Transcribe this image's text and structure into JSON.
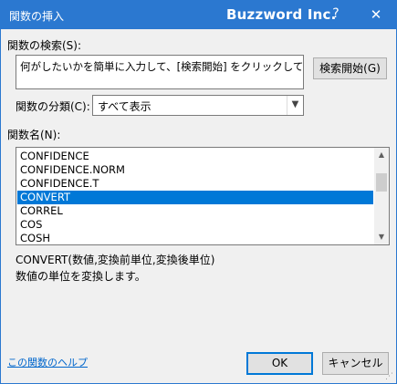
{
  "window": {
    "title": "関数の挿入",
    "brand": "Buzzword Inc.",
    "help_glyph": "?",
    "close_glyph": "✕"
  },
  "search": {
    "label": "関数の検索(S):",
    "text": "何がしたいかを簡単に入力して、[検索開始] をクリックしてください。",
    "button_label": "検索開始(G)"
  },
  "category": {
    "label": "関数の分類(C):",
    "selected": "すべて表示"
  },
  "function_list": {
    "label": "関数名(N):",
    "items": [
      "CONFIDENCE",
      "CONFIDENCE.NORM",
      "CONFIDENCE.T",
      "CONVERT",
      "CORREL",
      "COS",
      "COSH"
    ],
    "selected_index": 3
  },
  "description": {
    "syntax": "CONVERT(数値,変換前単位,変換後単位)",
    "text": "数値の単位を変換します。"
  },
  "footer": {
    "help_link": "この関数のヘルプ",
    "ok_label": "OK",
    "cancel_label": "キャンセル"
  },
  "colors": {
    "titlebar": "#2b78d0",
    "selection": "#0078d7",
    "link": "#0066cc"
  }
}
